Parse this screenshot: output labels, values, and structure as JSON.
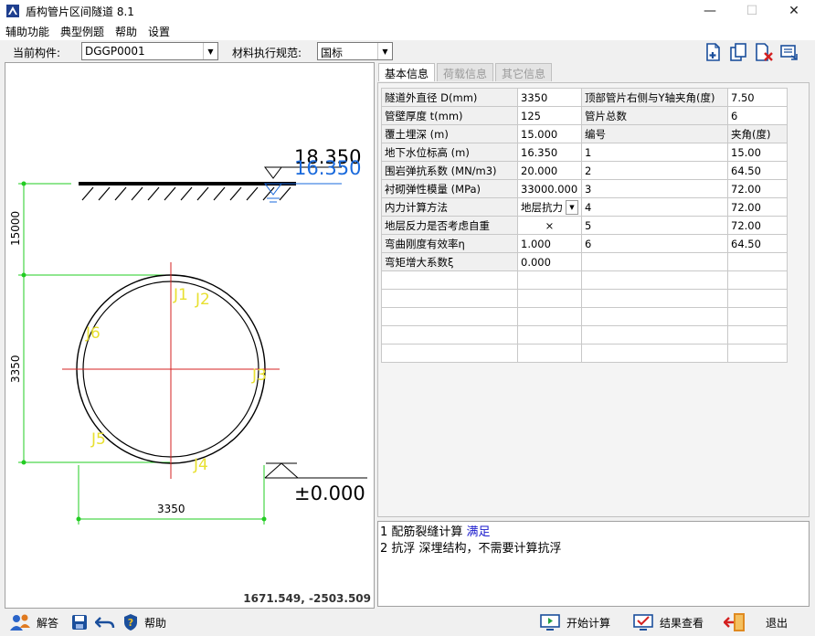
{
  "window": {
    "title": "盾构管片区间隧道 8.1",
    "min_glyph": "—",
    "max_glyph": "☐",
    "close_glyph": "✕"
  },
  "menu": [
    "辅助功能",
    "典型例题",
    "帮助",
    "设置"
  ],
  "toolbar": {
    "member_label": "当前构件:",
    "member_value": "DGGP0001",
    "spec_label": "材料执行规范:",
    "spec_value": "国标"
  },
  "drawing": {
    "elev_label_1": "18.350",
    "elev_label_2": "16.350",
    "zero_label": "±0.000",
    "dim_vertical_top": "15000",
    "dim_vertical_bottom": "3350",
    "dim_horizontal": "3350",
    "joints": [
      "J1",
      "J2",
      "J3",
      "J4",
      "J5",
      "J6"
    ],
    "coords": "1671.549, -2503.509"
  },
  "tabs": [
    "基本信息",
    "荷载信息",
    "其它信息"
  ],
  "params": [
    {
      "label": "隧道外直径 D(mm)",
      "value": "3350"
    },
    {
      "label": "管壁厚度 t(mm)",
      "value": "125"
    },
    {
      "label": "覆土埋深 (m)",
      "value": "15.000"
    },
    {
      "label": "地下水位标高 (m)",
      "value": "16.350"
    },
    {
      "label": "围岩弹抗系数 (MN/m3)",
      "value": "20.000"
    },
    {
      "label": "衬砌弹性模量 (MPa)",
      "value": "33000.000"
    },
    {
      "label": "内力计算方法",
      "value": "地层抗力"
    },
    {
      "label": "地层反力是否考虑自重",
      "value": "×"
    },
    {
      "label": "弯曲刚度有效率η",
      "value": "1.000"
    },
    {
      "label": "弯矩增大系数ξ",
      "value": "0.000"
    }
  ],
  "segments": {
    "angle_label": "顶部管片右侧与Y轴夹角(度)",
    "angle_value": "7.50",
    "count_label": "管片总数",
    "count_value": "6",
    "no_header": "编号",
    "angle_header": "夹角(度)",
    "rows": [
      {
        "no": "1",
        "angle": "15.00"
      },
      {
        "no": "2",
        "angle": "64.50"
      },
      {
        "no": "3",
        "angle": "72.00"
      },
      {
        "no": "4",
        "angle": "72.00"
      },
      {
        "no": "5",
        "angle": "72.00"
      },
      {
        "no": "6",
        "angle": "64.50"
      }
    ]
  },
  "messages": {
    "line1_prefix": "1 配筋裂缝计算",
    "line1_status": "满足",
    "line2": "2 抗浮 深埋结构，不需要计算抗浮"
  },
  "bottom": {
    "answer": "解答",
    "help": "帮助",
    "start": "开始计算",
    "result": "结果查看",
    "exit": "退出"
  }
}
